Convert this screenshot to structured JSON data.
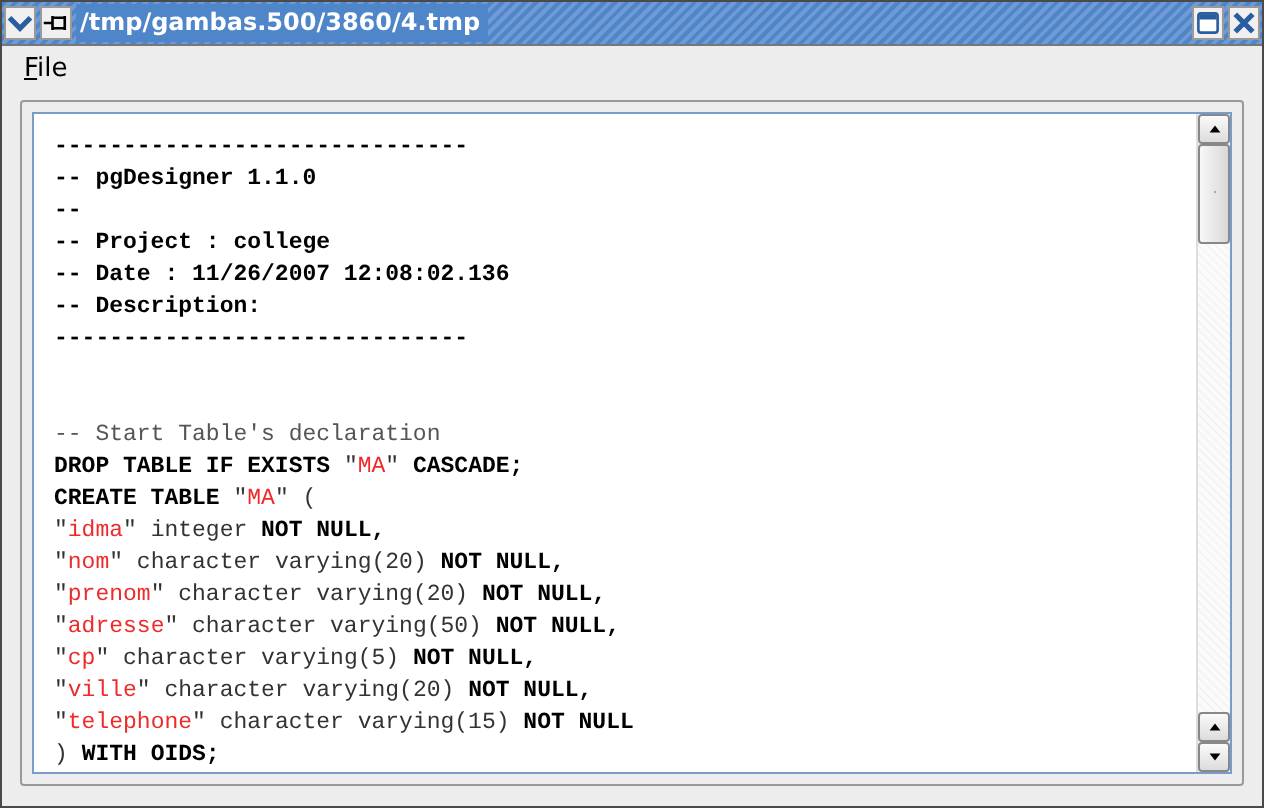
{
  "window": {
    "title": "/tmp/gambas.500/3860/4.tmp"
  },
  "menu": [
    {
      "label": "File"
    }
  ],
  "editor": {
    "lines": [
      {
        "kind": "code",
        "segments": [
          {
            "kind": "bold",
            "text": "------------------------------"
          }
        ]
      },
      {
        "kind": "code",
        "segments": [
          {
            "kind": "bold",
            "text": "-- pgDesigner 1.1.0"
          }
        ]
      },
      {
        "kind": "code",
        "segments": [
          {
            "kind": "bold",
            "text": "--"
          }
        ]
      },
      {
        "kind": "code",
        "segments": [
          {
            "kind": "bold",
            "text": "-- Project : college"
          }
        ]
      },
      {
        "kind": "code",
        "segments": [
          {
            "kind": "bold",
            "text": "-- Date : 11/26/2007 12:08:02.136"
          }
        ]
      },
      {
        "kind": "code",
        "segments": [
          {
            "kind": "bold",
            "text": "-- Description:"
          }
        ]
      },
      {
        "kind": "code",
        "segments": [
          {
            "kind": "bold",
            "text": "------------------------------"
          }
        ]
      },
      {
        "kind": "blank"
      },
      {
        "kind": "blank"
      },
      {
        "kind": "code",
        "segments": [
          {
            "kind": "comment",
            "text": "-- Start Table's declaration"
          }
        ]
      },
      {
        "kind": "code",
        "segments": [
          {
            "kind": "bold",
            "text": "DROP TABLE IF EXISTS "
          },
          {
            "kind": "plain",
            "text": "\""
          },
          {
            "kind": "string",
            "text": "MA"
          },
          {
            "kind": "plain",
            "text": "\" "
          },
          {
            "kind": "bold",
            "text": "CASCADE;"
          }
        ]
      },
      {
        "kind": "code",
        "segments": [
          {
            "kind": "bold",
            "text": "CREATE TABLE "
          },
          {
            "kind": "plain",
            "text": "\""
          },
          {
            "kind": "string",
            "text": "MA"
          },
          {
            "kind": "plain",
            "text": "\" ("
          }
        ]
      },
      {
        "kind": "code",
        "segments": [
          {
            "kind": "plain",
            "text": "\""
          },
          {
            "kind": "string",
            "text": "idma"
          },
          {
            "kind": "plain",
            "text": "\" integer "
          },
          {
            "kind": "bold",
            "text": "NOT NULL,"
          }
        ]
      },
      {
        "kind": "code",
        "segments": [
          {
            "kind": "plain",
            "text": "\""
          },
          {
            "kind": "string",
            "text": "nom"
          },
          {
            "kind": "plain",
            "text": "\" character varying(20) "
          },
          {
            "kind": "bold",
            "text": "NOT NULL,"
          }
        ]
      },
      {
        "kind": "code",
        "segments": [
          {
            "kind": "plain",
            "text": "\""
          },
          {
            "kind": "string",
            "text": "prenom"
          },
          {
            "kind": "plain",
            "text": "\" character varying(20) "
          },
          {
            "kind": "bold",
            "text": "NOT NULL,"
          }
        ]
      },
      {
        "kind": "code",
        "segments": [
          {
            "kind": "plain",
            "text": "\""
          },
          {
            "kind": "string",
            "text": "adresse"
          },
          {
            "kind": "plain",
            "text": "\" character varying(50) "
          },
          {
            "kind": "bold",
            "text": "NOT NULL,"
          }
        ]
      },
      {
        "kind": "code",
        "segments": [
          {
            "kind": "plain",
            "text": "\""
          },
          {
            "kind": "string",
            "text": "cp"
          },
          {
            "kind": "plain",
            "text": "\" character varying(5) "
          },
          {
            "kind": "bold",
            "text": "NOT NULL,"
          }
        ]
      },
      {
        "kind": "code",
        "segments": [
          {
            "kind": "plain",
            "text": "\""
          },
          {
            "kind": "string",
            "text": "ville"
          },
          {
            "kind": "plain",
            "text": "\" character varying(20) "
          },
          {
            "kind": "bold",
            "text": "NOT NULL,"
          }
        ]
      },
      {
        "kind": "code",
        "segments": [
          {
            "kind": "plain",
            "text": "\""
          },
          {
            "kind": "string",
            "text": "telephone"
          },
          {
            "kind": "plain",
            "text": "\" character varying(15) "
          },
          {
            "kind": "bold",
            "text": "NOT NULL"
          }
        ]
      },
      {
        "kind": "code",
        "segments": [
          {
            "kind": "plain",
            "text": ") "
          },
          {
            "kind": "bold",
            "text": "WITH OIDS;"
          }
        ]
      }
    ]
  }
}
